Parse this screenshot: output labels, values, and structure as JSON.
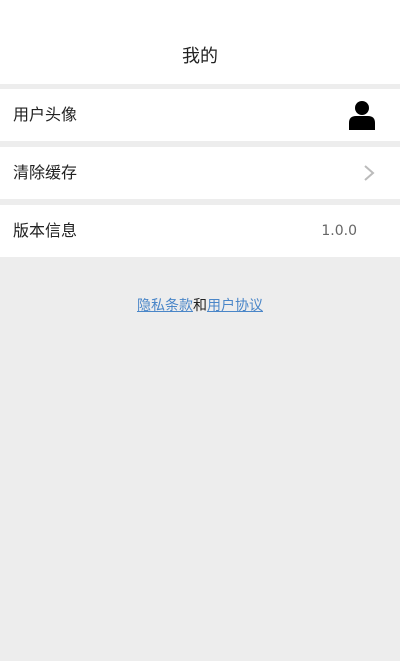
{
  "header": {
    "title": "我的"
  },
  "rows": [
    {
      "label": "用户头像",
      "accessory": "avatar-icon"
    },
    {
      "label": "清除缓存",
      "accessory": "chevron-right-icon"
    },
    {
      "label": "版本信息",
      "value": "1.0.0"
    }
  ],
  "links": {
    "privacy": "隐私条款",
    "conjunction": "和",
    "agreement": "用户协议",
    "color": "#4a86c8"
  },
  "colors": {
    "background": "#ededed",
    "surface": "#ffffff",
    "text": "#222222",
    "secondary_text": "#666666",
    "chevron": "#bbbbbb",
    "avatar": "#000000"
  }
}
